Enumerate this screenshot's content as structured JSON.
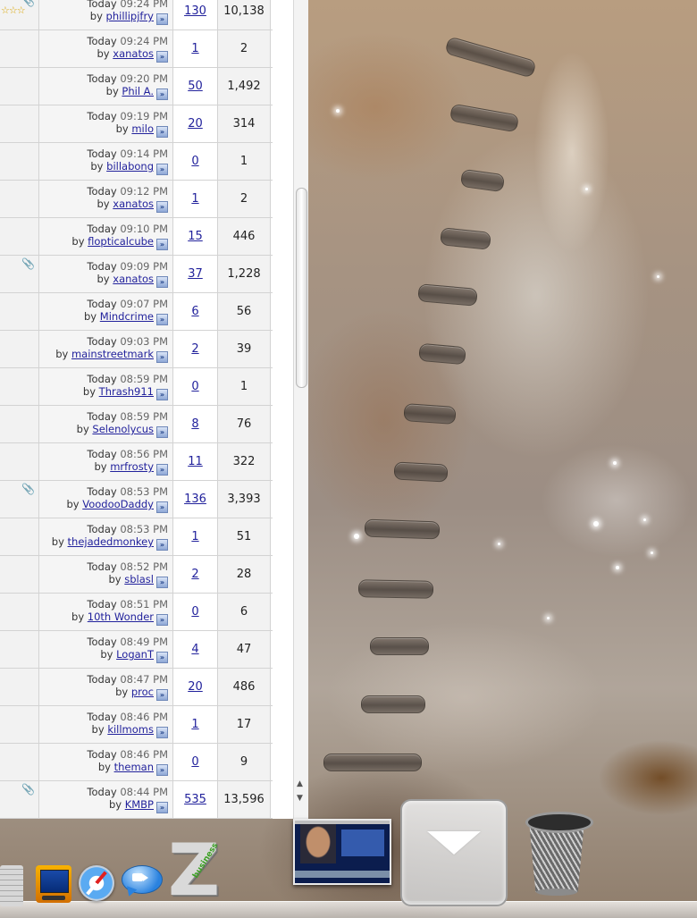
{
  "threads": [
    {
      "date": "Today",
      "time": "09:24 PM",
      "by": "by",
      "user": "phillipjfry",
      "replies": "130",
      "views": "10,138",
      "clip": true,
      "rating": "☆☆☆"
    },
    {
      "date": "Today",
      "time": "09:24 PM",
      "by": "by",
      "user": "xanatos",
      "replies": "1",
      "views": "2"
    },
    {
      "date": "Today",
      "time": "09:20 PM",
      "by": "by",
      "user": "Phil A.",
      "replies": "50",
      "views": "1,492"
    },
    {
      "date": "Today",
      "time": "09:19 PM",
      "by": "by",
      "user": "milo",
      "replies": "20",
      "views": "314"
    },
    {
      "date": "Today",
      "time": "09:14 PM",
      "by": "by",
      "user": "billabong",
      "replies": "0",
      "views": "1"
    },
    {
      "date": "Today",
      "time": "09:12 PM",
      "by": "by",
      "user": "xanatos",
      "replies": "1",
      "views": "2"
    },
    {
      "date": "Today",
      "time": "09:10 PM",
      "by": "by",
      "user": "flopticalcube",
      "replies": "15",
      "views": "446"
    },
    {
      "date": "Today",
      "time": "09:09 PM",
      "by": "by",
      "user": "xanatos",
      "replies": "37",
      "views": "1,228",
      "clip": true
    },
    {
      "date": "Today",
      "time": "09:07 PM",
      "by": "by",
      "user": "Mindcrime",
      "replies": "6",
      "views": "56"
    },
    {
      "date": "Today",
      "time": "09:03 PM",
      "by": "by",
      "user": "mainstreetmark",
      "replies": "2",
      "views": "39"
    },
    {
      "date": "Today",
      "time": "08:59 PM",
      "by": "by",
      "user": "Thrash911",
      "replies": "0",
      "views": "1"
    },
    {
      "date": "Today",
      "time": "08:59 PM",
      "by": "by",
      "user": "Selenolycus",
      "replies": "8",
      "views": "76"
    },
    {
      "date": "Today",
      "time": "08:56 PM",
      "by": "by",
      "user": "mrfrosty",
      "replies": "11",
      "views": "322"
    },
    {
      "date": "Today",
      "time": "08:53 PM",
      "by": "by",
      "user": "VoodooDaddy",
      "replies": "136",
      "views": "3,393",
      "clip": true
    },
    {
      "date": "Today",
      "time": "08:53 PM",
      "by": "by",
      "user": "thejadedmonkey",
      "replies": "1",
      "views": "51"
    },
    {
      "date": "Today",
      "time": "08:52 PM",
      "by": "by",
      "user": "sblasl",
      "replies": "2",
      "views": "28"
    },
    {
      "date": "Today",
      "time": "08:51 PM",
      "by": "by",
      "user": "10th Wonder",
      "replies": "0",
      "views": "6"
    },
    {
      "date": "Today",
      "time": "08:49 PM",
      "by": "by",
      "user": "LoganT",
      "replies": "4",
      "views": "47"
    },
    {
      "date": "Today",
      "time": "08:47 PM",
      "by": "by",
      "user": "proc",
      "replies": "20",
      "views": "486"
    },
    {
      "date": "Today",
      "time": "08:46 PM",
      "by": "by",
      "user": "killmoms",
      "replies": "1",
      "views": "17"
    },
    {
      "date": "Today",
      "time": "08:46 PM",
      "by": "by",
      "user": "theman",
      "replies": "0",
      "views": "9"
    },
    {
      "date": "Today",
      "time": "08:44 PM",
      "by": "by",
      "user": "KMBP",
      "replies": "535",
      "views": "13,596",
      "clip": true
    }
  ],
  "icons": {
    "goto_last_post": "»",
    "attachment": "📎",
    "scroll_up": "▲",
    "scroll_down": "▼"
  },
  "dock": {
    "items": [
      "calculator-icon",
      "monitor-icon",
      "safari-icon",
      "ichat-icon",
      "z-app-icon",
      "window-thumbnail",
      "stack-icon",
      "trash-icon"
    ],
    "z_app_label": "business"
  }
}
